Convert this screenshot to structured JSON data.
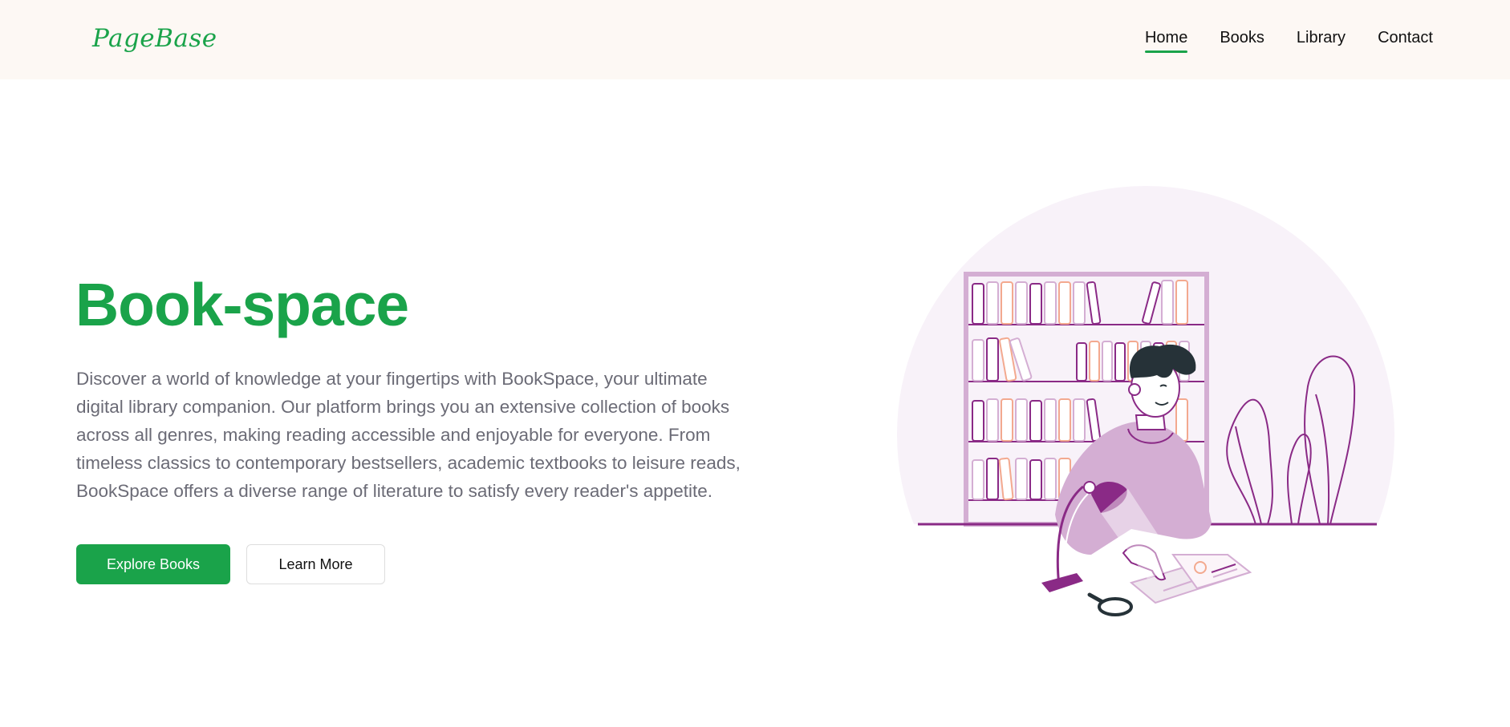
{
  "header": {
    "logo": "PageBase",
    "nav": [
      {
        "label": "Home",
        "active": true
      },
      {
        "label": "Books",
        "active": false
      },
      {
        "label": "Library",
        "active": false
      },
      {
        "label": "Contact",
        "active": false
      }
    ]
  },
  "hero": {
    "title": "Book-space",
    "description": "Discover a world of knowledge at your fingertips with BookSpace, your ultimate digital library companion. Our platform brings you an extensive collection of books across all genres, making reading accessible and enjoyable for everyone. From timeless classics to contemporary bestsellers, academic textbooks to leisure reads, BookSpace offers a diverse range of literature to satisfy every reader's appetite.",
    "primary_button": "Explore Books",
    "secondary_button": "Learn More"
  },
  "illustration": {
    "icon": "reader-at-bookshelf-illustration"
  },
  "colors": {
    "accent": "#1aa34a",
    "header_bg": "#fdf8f4",
    "body_text": "#6b6b76",
    "illustration_purple": "#8a2a86",
    "illustration_lilac": "#d4aed3"
  }
}
